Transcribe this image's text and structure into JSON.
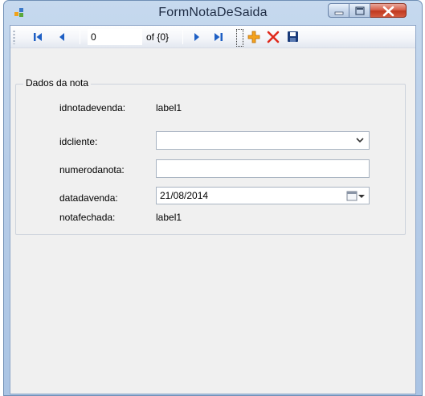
{
  "window": {
    "title": "FormNotaDeSaida"
  },
  "navigator": {
    "position": "0",
    "count_label": "of {0}"
  },
  "group": {
    "title": "Dados da nota"
  },
  "fields": {
    "idnotadevenda_label": "idnotadevenda:",
    "idnotadevenda_value": "label1",
    "idcliente_label": "idcliente:",
    "idcliente_value": "",
    "numerodanota_label": "numerodanota:",
    "numerodanota_value": "",
    "datadavenda_label": "datadavenda:",
    "datadavenda_value": "21/08/2014",
    "notafechada_label": "notafechada:",
    "notafechada_value": "label1"
  },
  "icons": {
    "app": "form-icon",
    "move_first": "move-first-icon",
    "move_previous": "move-previous-icon",
    "move_next": "move-next-icon",
    "move_last": "move-last-icon",
    "add_new": "add-icon",
    "delete": "delete-icon",
    "save": "save-icon"
  },
  "colors": {
    "nav_blue": "#1e5fc4",
    "add_orange": "#f4a21d",
    "delete_red": "#e0291b",
    "save_navy": "#1a3b7a"
  }
}
